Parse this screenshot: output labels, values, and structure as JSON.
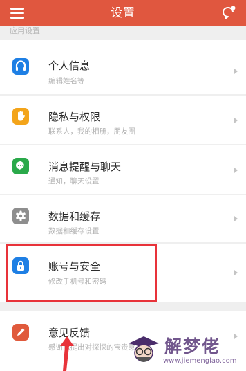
{
  "header": {
    "title": "设置",
    "menu_icon": "hamburger-menu-icon",
    "right_icon": "chat-bubble-icon"
  },
  "section_label": "应用设置",
  "items": [
    {
      "label": "个人信息",
      "sub": "编辑姓名等",
      "icon": "person-icon",
      "color": "#1e7fe4"
    },
    {
      "label": "隐私与权限",
      "sub": "联系人，我的相册，朋友圈",
      "icon": "hand-icon",
      "color": "#f3a41a"
    },
    {
      "label": "消息提醒与聊天",
      "sub": "通知，聊天设置",
      "icon": "chat-icon",
      "color": "#2aa94a"
    },
    {
      "label": "数据和缓存",
      "sub": "数据和缓存设置",
      "icon": "gear-icon",
      "color": "#8e8e8e"
    },
    {
      "label": "账号与安全",
      "sub": "修改手机号和密码",
      "icon": "lock-icon",
      "color": "#1e7fe4"
    },
    {
      "label": "意见反馈",
      "sub": "感谢您提出对探探的宝贵意见",
      "icon": "pencil-icon",
      "color": "#e05a3c"
    }
  ],
  "colors": {
    "header_bg": "#e0573f",
    "highlight": "#e8333a"
  },
  "watermark": {
    "name": "解梦佬",
    "url": "www.jiemenglao.com"
  }
}
